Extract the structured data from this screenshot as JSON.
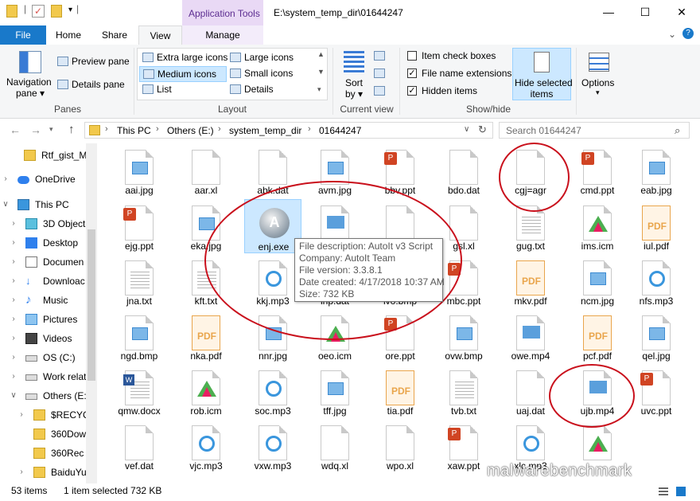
{
  "title_bar": {
    "context_tab": "Application Tools",
    "window_title": "E:\\system_temp_dir\\01644247",
    "minimize": "—",
    "maximize": "☐",
    "close": "✕"
  },
  "ribbon_tabs": {
    "file": "File",
    "home": "Home",
    "share": "Share",
    "view": "View",
    "manage": "Manage"
  },
  "ribbon": {
    "panes": {
      "navigation_pane": "Navigation",
      "navigation_pane_2": "pane ▾",
      "preview_pane": "Preview pane",
      "details_pane": "Details pane",
      "label": "Panes"
    },
    "layout": {
      "items": [
        "Extra large icons",
        "Large icons",
        "Medium icons",
        "Small icons",
        "List",
        "Details"
      ],
      "selected": "Medium icons",
      "label": "Layout"
    },
    "current_view": {
      "sort_by": "Sort",
      "sort_by_2": "by ▾",
      "label": "Current view"
    },
    "show_hide": {
      "item_check_boxes": "Item check boxes",
      "item_check_boxes_checked": false,
      "file_name_extensions": "File name extensions",
      "file_name_extensions_checked": true,
      "hidden_items": "Hidden items",
      "hidden_items_checked": true,
      "hide_selected": "Hide selected",
      "hide_selected_2": "items",
      "label": "Show/hide"
    },
    "options": "Options"
  },
  "address_bar": {
    "crumbs": [
      "This PC",
      "Others (E:)",
      "system_temp_dir",
      "01644247"
    ],
    "search_placeholder": "Search 01644247"
  },
  "nav_pane": {
    "items": [
      {
        "label": "Rtf_gist_M",
        "icon": "folder-icon"
      },
      {
        "label": "OneDrive",
        "icon": "cloud-icon"
      },
      {
        "label": "This PC",
        "icon": "computer-icon"
      },
      {
        "label": "3D Object",
        "icon": "cube-icon"
      },
      {
        "label": "Desktop",
        "icon": "desktop-icon"
      },
      {
        "label": "Documen",
        "icon": "documents-icon"
      },
      {
        "label": "Downloac",
        "icon": "download-icon"
      },
      {
        "label": "Music",
        "icon": "music-icon"
      },
      {
        "label": "Pictures",
        "icon": "pictures-icon"
      },
      {
        "label": "Videos",
        "icon": "videos-icon"
      },
      {
        "label": "OS (C:)",
        "icon": "drive-icon"
      },
      {
        "label": "Work relat",
        "icon": "drive-icon"
      },
      {
        "label": "Others (E:",
        "icon": "drive-icon"
      },
      {
        "label": "$RECYCI",
        "icon": "folder-icon"
      },
      {
        "label": "360Dowr",
        "icon": "folder-icon"
      },
      {
        "label": "360Rec",
        "icon": "folder-icon"
      },
      {
        "label": "BaiduYu",
        "icon": "folder-icon"
      }
    ]
  },
  "files": [
    {
      "name": "aai.jpg",
      "type": "jpg"
    },
    {
      "name": "aar.xl",
      "type": "blank"
    },
    {
      "name": "abk.dat",
      "type": "blank"
    },
    {
      "name": "avm.jpg",
      "type": "jpg"
    },
    {
      "name": "bbv.ppt",
      "type": "ppt"
    },
    {
      "name": "bdo.dat",
      "type": "blank"
    },
    {
      "name": "cgj=agr",
      "type": "blank"
    },
    {
      "name": "cmd.ppt",
      "type": "ppt"
    },
    {
      "name": "eab.jpg",
      "type": "jpg"
    },
    {
      "name": "ejg.ppt",
      "type": "ppt"
    },
    {
      "name": "eka.jpg",
      "type": "jpg"
    },
    {
      "name": "enj.exe",
      "type": "autoit"
    },
    {
      "name": "",
      "type": "mp4"
    },
    {
      "name": "",
      "type": "blank"
    },
    {
      "name": "gsl.xl",
      "type": "blank"
    },
    {
      "name": "gug.txt",
      "type": "txt"
    },
    {
      "name": "ims.icm",
      "type": "icm"
    },
    {
      "name": "iul.pdf",
      "type": "pdf"
    },
    {
      "name": "jna.txt",
      "type": "txt"
    },
    {
      "name": "kft.txt",
      "type": "txt"
    },
    {
      "name": "kkj.mp3",
      "type": "mp3"
    },
    {
      "name": "lnp.dat",
      "type": "blank"
    },
    {
      "name": "lvo.bmp",
      "type": "jpg"
    },
    {
      "name": "mbc.ppt",
      "type": "ppt"
    },
    {
      "name": "mkv.pdf",
      "type": "pdf"
    },
    {
      "name": "ncm.jpg",
      "type": "jpg"
    },
    {
      "name": "nfs.mp3",
      "type": "mp3"
    },
    {
      "name": "ngd.bmp",
      "type": "jpg"
    },
    {
      "name": "nka.pdf",
      "type": "pdf"
    },
    {
      "name": "nnr.jpg",
      "type": "jpg"
    },
    {
      "name": "oeo.icm",
      "type": "icm"
    },
    {
      "name": "ore.ppt",
      "type": "ppt"
    },
    {
      "name": "ovw.bmp",
      "type": "jpg"
    },
    {
      "name": "owe.mp4",
      "type": "mp4"
    },
    {
      "name": "pcf.pdf",
      "type": "pdf"
    },
    {
      "name": "qel.jpg",
      "type": "jpg"
    },
    {
      "name": "qmw.docx",
      "type": "docx"
    },
    {
      "name": "rob.icm",
      "type": "icm"
    },
    {
      "name": "soc.mp3",
      "type": "mp3"
    },
    {
      "name": "tff.jpg",
      "type": "jpg"
    },
    {
      "name": "tia.pdf",
      "type": "pdf"
    },
    {
      "name": "tvb.txt",
      "type": "txt"
    },
    {
      "name": "uaj.dat",
      "type": "blank"
    },
    {
      "name": "ujb.mp4",
      "type": "mp4"
    },
    {
      "name": "uvc.ppt",
      "type": "ppt"
    },
    {
      "name": "vef.dat",
      "type": "blank"
    },
    {
      "name": "vjc.mp3",
      "type": "mp3"
    },
    {
      "name": "vxw.mp3",
      "type": "mp3"
    },
    {
      "name": "wdq.xl",
      "type": "blank"
    },
    {
      "name": "wpo.xl",
      "type": "blank"
    },
    {
      "name": "xaw.ppt",
      "type": "ppt"
    },
    {
      "name": "xlc.mp3",
      "type": "mp3"
    },
    {
      "name": "",
      "type": "icm"
    }
  ],
  "tooltip": {
    "lines": [
      "File description: AutoIt v3 Script",
      "Company: AutoIt Team",
      "File version: 3.3.8.1",
      "Date created: 4/17/2018 10:37 AM",
      "Size: 732 KB"
    ]
  },
  "status_bar": {
    "item_count": "53 items",
    "selection": "1 item selected  732 KB"
  },
  "watermark": "malwarebenchmark",
  "colors": {
    "file_tab": "#1979ca",
    "context_tab": "#5c2d91",
    "selection": "#cce8ff",
    "annotation_ring": "#c9101c"
  }
}
